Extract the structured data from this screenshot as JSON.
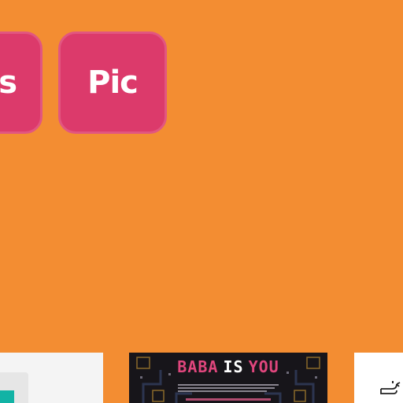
{
  "tags": [
    {
      "label": "s"
    },
    {
      "label": "Pic"
    }
  ],
  "thumbnails": {
    "baba": {
      "title_words": [
        "BABA",
        "IS",
        "YOU"
      ]
    },
    "right_icon": "whale-icon"
  },
  "colors": {
    "background": "#f38d32",
    "tag_tile": "#dc3a6b",
    "baba_pink": "#e0467d"
  }
}
